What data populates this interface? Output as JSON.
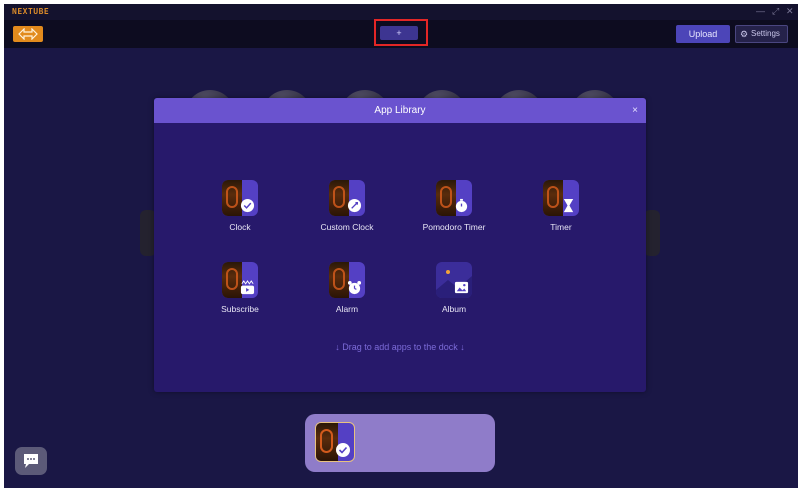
{
  "app": {
    "brand": "NEXTUBE"
  },
  "window_controls": [
    "—",
    "⤢",
    "✕"
  ],
  "toolbar": {
    "add_label": "+",
    "upload_label": "Upload",
    "settings_label": "Settings",
    "settings_icon": "⚙"
  },
  "modal": {
    "title": "App Library",
    "close": "×",
    "hint": "↓ Drag to add apps to the dock ↓"
  },
  "apps": [
    {
      "label": "Clock",
      "icon": "clock-app-icon"
    },
    {
      "label": "Custom Clock",
      "icon": "custom-clock-app-icon"
    },
    {
      "label": "Pomodoro Timer",
      "icon": "pomodoro-timer-app-icon"
    },
    {
      "label": "Timer",
      "icon": "timer-app-icon"
    },
    {
      "label": "Subscribe",
      "icon": "subscribe-app-icon"
    },
    {
      "label": "Alarm",
      "icon": "alarm-app-icon"
    },
    {
      "label": "Album",
      "icon": "album-app-icon"
    }
  ],
  "dock": {
    "items": [
      {
        "app": "Clock",
        "icon": "clock-app-icon"
      }
    ]
  },
  "colors": {
    "accent": "#6a53cf",
    "background": "#1a1745",
    "modal": "#27196b",
    "brand": "#d98a2a",
    "highlight": "#e32626"
  }
}
